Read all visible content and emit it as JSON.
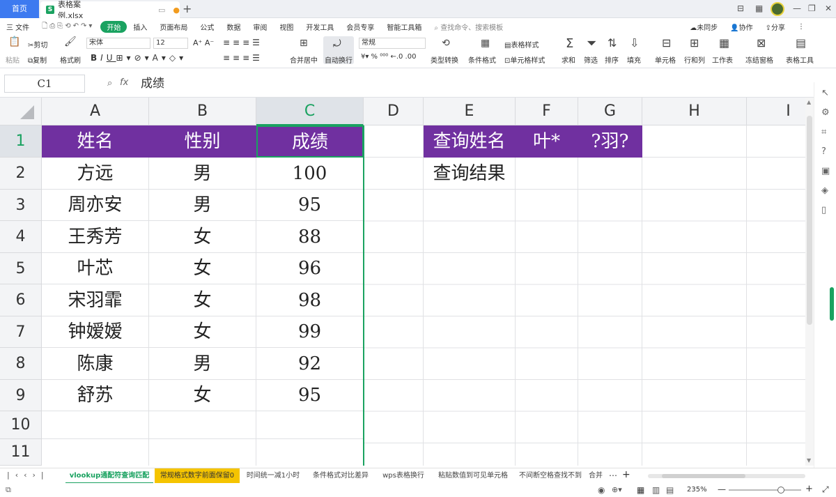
{
  "titlebar": {
    "home_tab": "首页",
    "file_tab": "表格案例.xlsx",
    "file_icon": "S",
    "add_tab": "+"
  },
  "menu": {
    "file": "三 文件",
    "items": [
      "开始",
      "插入",
      "页面布局",
      "公式",
      "数据",
      "审阅",
      "视图",
      "开发工具",
      "会员专享",
      "智能工具箱"
    ],
    "search_placeholder": "查找命令、搜索模板",
    "sync": "未同步",
    "collab": "协作",
    "share": "分享"
  },
  "ribbon": {
    "paste": "粘贴",
    "cut": "剪切",
    "copy": "复制",
    "format_painter": "格式刷",
    "font_name": "宋体",
    "font_size": "12",
    "merge_center": "合并居中",
    "auto_wrap": "自动换行",
    "number_format": "常规",
    "type_convert": "类型转换",
    "cond_format": "条件格式",
    "table_style": "表格样式",
    "cell_style": "单元格样式",
    "sum": "求和",
    "filter": "筛选",
    "sort": "排序",
    "fill": "填充",
    "cell": "单元格",
    "rows_cols": "行和列",
    "worksheet": "工作表",
    "freeze": "冻结窗格",
    "table_tools": "表格工具"
  },
  "formula_bar": {
    "cell_ref": "C1",
    "fx": "fx",
    "content": "成绩"
  },
  "columns": [
    "A",
    "B",
    "C",
    "D",
    "E",
    "F",
    "G",
    "H",
    "I"
  ],
  "rows": [
    "1",
    "2",
    "3",
    "4",
    "5",
    "6",
    "7",
    "8",
    "9",
    "10",
    "11"
  ],
  "table": {
    "headers": [
      "姓名",
      "性别",
      "成绩"
    ],
    "data": [
      [
        "方远",
        "男",
        "100"
      ],
      [
        "周亦安",
        "男",
        "95"
      ],
      [
        "王秀芳",
        "女",
        "88"
      ],
      [
        "叶芯",
        "女",
        "96"
      ],
      [
        "宋羽霏",
        "女",
        "98"
      ],
      [
        "钟嫒嫒",
        "女",
        "99"
      ],
      [
        "陈康",
        "男",
        "92"
      ],
      [
        "舒苏",
        "女",
        "95"
      ]
    ]
  },
  "query": {
    "label": "查询姓名",
    "f1": "叶*",
    "g1": "?羽?",
    "result_label": "查询结果"
  },
  "sheet_tabs": [
    "vlookup通配符查询匹配",
    "常规格式数字前面保留0",
    "时间统一减1小时",
    "条件格式对比差异",
    "wps表格换行",
    "粘贴数值到可见单元格",
    "不间断空格查找不到",
    "合并"
  ],
  "status": {
    "zoom": "235%"
  },
  "colors": {
    "header_fill": "#7030a0",
    "accent_green": "#1aa260",
    "selection": "#1aa260",
    "home_blue": "#3d7af0"
  }
}
